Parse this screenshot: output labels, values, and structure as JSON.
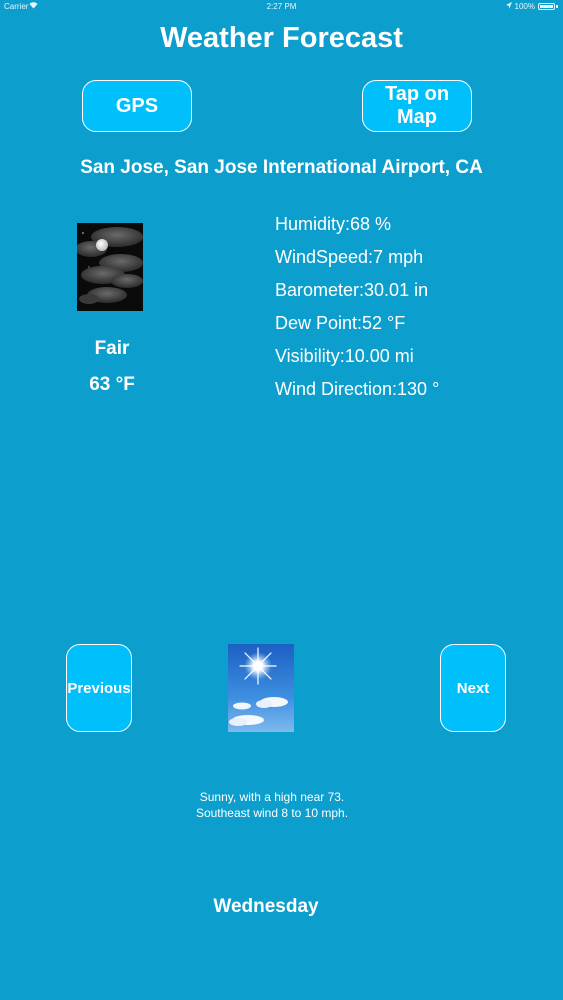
{
  "status_bar": {
    "carrier": "Carrier",
    "time": "2:27 PM",
    "battery": "100%"
  },
  "title": "Weather Forecast",
  "buttons": {
    "gps": "GPS",
    "map": "Tap on Map",
    "previous": "Previous",
    "next": "Next"
  },
  "location": "San Jose, San Jose International Airport, CA",
  "current": {
    "icon": "night-fair-moon-icon",
    "condition": "Fair",
    "temperature": "63 °F",
    "details": [
      "Humidity:68 %",
      "WindSpeed:7 mph",
      "Barometer:30.01 in",
      "Dew Point:52 °F",
      "Visibility:10.00 mi",
      "Wind Direction:130 °"
    ]
  },
  "forecast": {
    "icon": "sunny-sky-icon",
    "text_line1": "Sunny, with a high near 73.",
    "text_line2": "Southeast wind 8 to 10 mph.",
    "day": "Wednesday"
  },
  "colors": {
    "background": "#0c9fcd",
    "button": "#00c0fb",
    "text": "#ffffff"
  }
}
